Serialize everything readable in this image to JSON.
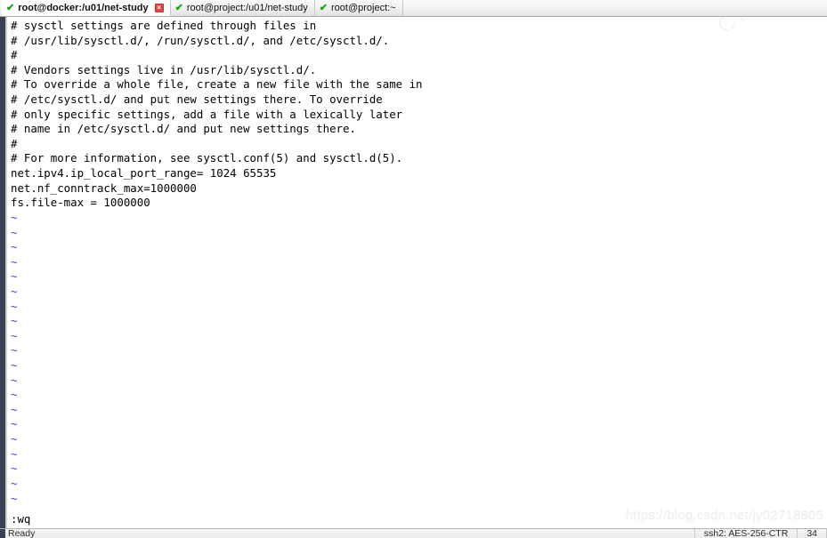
{
  "window": {
    "title": "root@docker:/u01/net-study",
    "accent_green": "#19a019",
    "close_red": "#d84a43",
    "tilde_color": "#4b3fd6"
  },
  "tabbar": {
    "tabs": [
      {
        "check": "✔",
        "label": "root@docker:/u01/net-study",
        "active": true,
        "close": "×"
      },
      {
        "check": "✔",
        "label": "root@project:/u01/net-study",
        "active": false,
        "close": ""
      },
      {
        "check": "✔",
        "label": "root@project:~",
        "active": false,
        "close": ""
      }
    ]
  },
  "terminal": {
    "lines": [
      "# sysctl settings are defined through files in",
      "# /usr/lib/sysctl.d/, /run/sysctl.d/, and /etc/sysctl.d/.",
      "#",
      "# Vendors settings live in /usr/lib/sysctl.d/.",
      "# To override a whole file, create a new file with the same in",
      "# /etc/sysctl.d/ and put new settings there. To override",
      "# only specific settings, add a file with a lexically later",
      "# name in /etc/sysctl.d/ and put new settings there.",
      "#",
      "# For more information, see sysctl.conf(5) and sysctl.d(5).",
      "net.ipv4.ip_local_port_range= 1024 65535",
      "net.nf_conntrack_max=1000000",
      "fs.file-max = 1000000"
    ],
    "empty_marker": "~",
    "empty_line_count": 20,
    "command_line": ":wq"
  },
  "watermarks": {
    "bottom": "https://blog.csdn.net/jy02718805",
    "top": "CTR"
  },
  "statusbar": {
    "state": "Ready",
    "cipher": "ssh2: AES-256-CTR",
    "position": "34"
  }
}
